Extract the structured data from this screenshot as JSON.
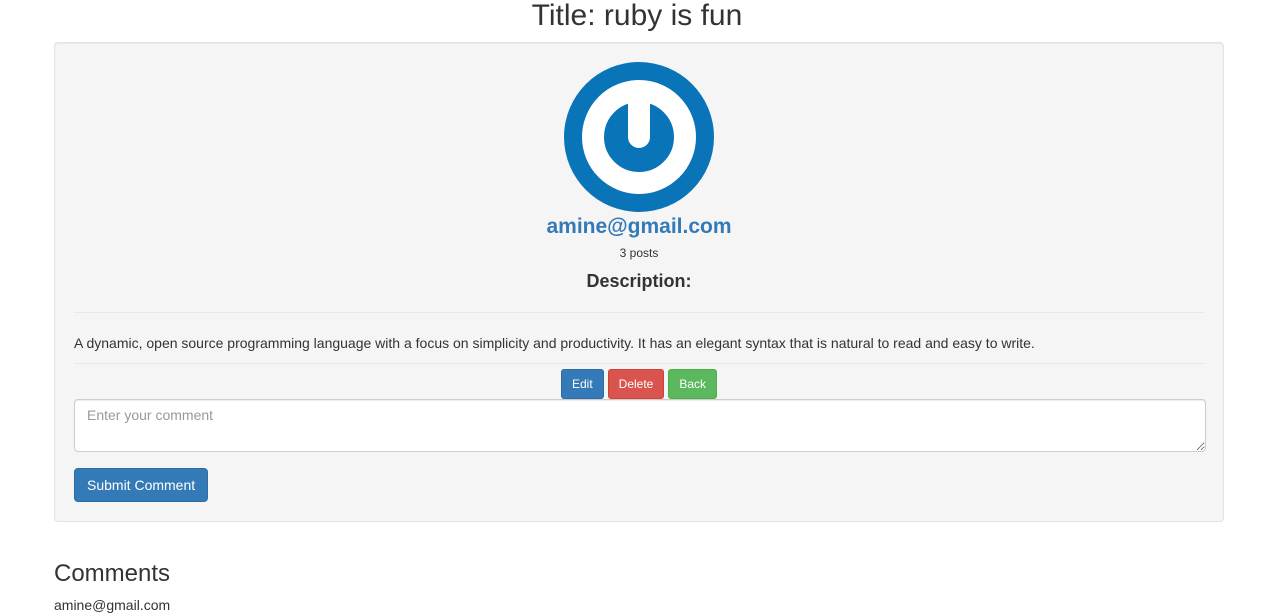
{
  "page": {
    "title": "Title: ruby is fun"
  },
  "post": {
    "author_email": "amine@gmail.com",
    "post_count": "3 posts",
    "description_heading": "Description:",
    "description": "A dynamic, open source programming language with a focus on simplicity and productivity. It has an elegant syntax that is natural to read and easy to write.",
    "avatar_icon": "gravatar-logo-icon"
  },
  "actions": {
    "edit_label": "Edit",
    "delete_label": "Delete",
    "back_label": "Back"
  },
  "comment_form": {
    "placeholder": "Enter your comment",
    "value": "",
    "submit_label": "Submit Comment"
  },
  "comments": {
    "heading": "Comments",
    "items": [
      {
        "author": "amine@gmail.com"
      }
    ]
  },
  "colors": {
    "primary": "#337ab7",
    "danger": "#d9534f",
    "success": "#5cb85c",
    "well_background": "#f5f5f5",
    "avatar_blue": "#0a74b8"
  }
}
